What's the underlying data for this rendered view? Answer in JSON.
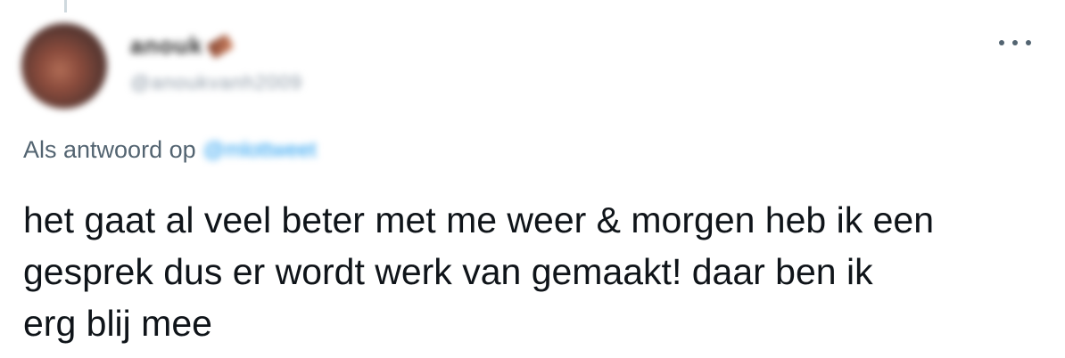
{
  "tweet": {
    "display_name": "anouk",
    "handle": "@anoukvanh2009",
    "reply_prefix": "Als antwoord op",
    "reply_mention": "@mlottweet",
    "text": "het gaat al veel beter met me weer & morgen heb ik een\ngesprek dus er wordt werk van gemaakt! daar ben ik\nerg blij mee",
    "more_icon": "more-horizontal-icon"
  }
}
